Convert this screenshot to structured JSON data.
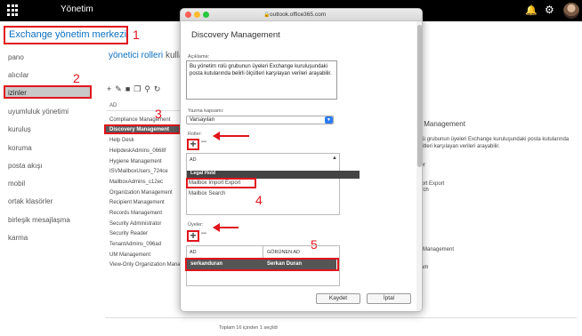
{
  "topbar": {
    "app_name": "Yönetim"
  },
  "page": {
    "title": "Exchange yönetim merkezi"
  },
  "annotations": {
    "n1": "1",
    "n2": "2",
    "n3": "3",
    "n4": "4",
    "n5": "5"
  },
  "nav": {
    "items": [
      "pano",
      "alıcılar",
      "izinler",
      "uyumluluk yönetimi",
      "kuruluş",
      "koruma",
      "posta akışı",
      "mobil",
      "ortak klasörler",
      "birleşik mesajlaşma",
      "karma"
    ],
    "selected": "izinler"
  },
  "main": {
    "tabs": [
      "yönetici rolleri",
      "kullan"
    ],
    "toolbar_icons": [
      "add-icon",
      "edit-icon",
      "delete-icon",
      "copy-icon",
      "search-icon",
      "refresh-icon"
    ],
    "column_header": "AD",
    "roles": [
      "Compliance Management",
      "Discovery Management",
      "Help Desk",
      "HelpdeskAdmins_0668f",
      "Hygiene Management",
      "ISVMailboxUsers_724ce",
      "MailboxAdmins_c12ec",
      "Organization Management",
      "Recipient Management",
      "Records Management",
      "Security Administrator",
      "Security Reader",
      "TenantAdmins_096ad",
      "UM Management",
      "View-Only Organization Manag"
    ],
    "selected_role": "Discovery Management",
    "footer": "Toplam 16 içinden 1 seçildi",
    "detail": {
      "title": "y Management",
      "desc_line1": "olü grubunun üyeleri Exchange kuruluşundaki posta kutularında",
      "desc_line2": "çütleri karşılayan verileri arayabilir.",
      "line3": "ller",
      "line4": "port Export",
      "line5": "arch",
      "line6": "n Management",
      "line7": "sam"
    }
  },
  "modal": {
    "url": "outlook.office365.com",
    "title": "Discovery Management",
    "desc_label": "Açıklama:",
    "description": "Bu yönetim rolü grubunun üyeleri Exchange kuruluşundaki posta kutularında belirli ölçütleri karşılayan verileri arayabilir.",
    "scope_label": "Yazma kapsamı:",
    "scope_value": "Varsayılan",
    "roles_label": "Roller:",
    "roles_col": "AD",
    "roles": [
      "Legal Hold",
      "Mailbox Import Export",
      "Mailbox Search"
    ],
    "members_label": "Üyeler:",
    "members_cols": [
      "AD",
      "GÖRÜNEN AD"
    ],
    "member": {
      "name": "serkanduran",
      "display": "Serkan Duran"
    },
    "save": "Kaydet",
    "cancel": "İptal"
  },
  "colors": {
    "accent": "#0a6fc2",
    "annotation": "#e0141c"
  }
}
